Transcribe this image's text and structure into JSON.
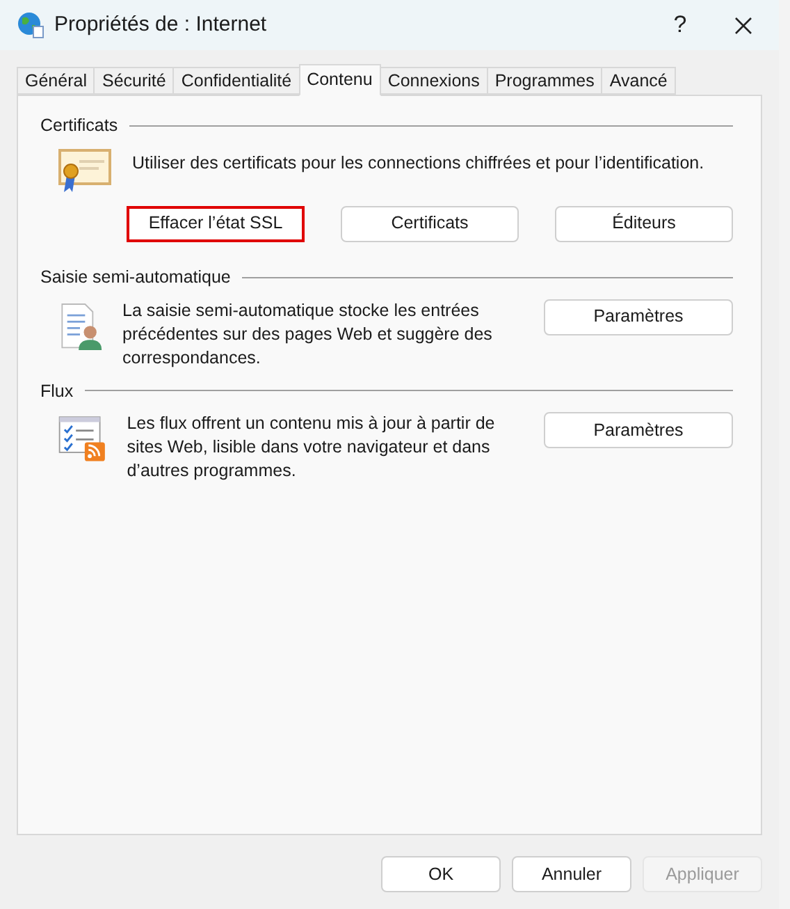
{
  "window": {
    "title": "Propriétés de : Internet",
    "help": "?"
  },
  "tabs": [
    {
      "label": "Général",
      "selected": false
    },
    {
      "label": "Sécurité",
      "selected": false
    },
    {
      "label": "Confidentialité",
      "selected": false
    },
    {
      "label": "Contenu",
      "selected": true
    },
    {
      "label": "Connexions",
      "selected": false
    },
    {
      "label": "Programmes",
      "selected": false
    },
    {
      "label": "Avancé",
      "selected": false
    }
  ],
  "sections": [
    {
      "title": "Certificats",
      "kind": "certificate",
      "description": "Utiliser des certificats pour les connections chiffrées et pour l’identification.",
      "buttons": [
        {
          "label": "Effacer l’état SSL",
          "highlighted": true
        },
        {
          "label": "Certificats",
          "highlighted": false
        },
        {
          "label": "Éditeurs",
          "highlighted": false
        }
      ]
    },
    {
      "title": "Saisie semi-automatique",
      "kind": "autocomplete",
      "description": "La saisie semi-automatique stocke les entrées précédentes sur des pages Web et suggère des correspondances.",
      "buttons": [
        {
          "label": "Paramètres",
          "highlighted": false
        }
      ]
    },
    {
      "title": "Flux",
      "kind": "feeds",
      "description": "Les flux offrent un contenu mis à jour à partir de sites Web, lisible dans votre navigateur et dans d’autres programmes.",
      "buttons": [
        {
          "label": "Paramètres",
          "highlighted": false
        }
      ]
    }
  ],
  "footer_buttons": [
    {
      "label": "OK",
      "disabled": false
    },
    {
      "label": "Annuler",
      "disabled": false
    },
    {
      "label": "Appliquer",
      "disabled": true
    }
  ]
}
